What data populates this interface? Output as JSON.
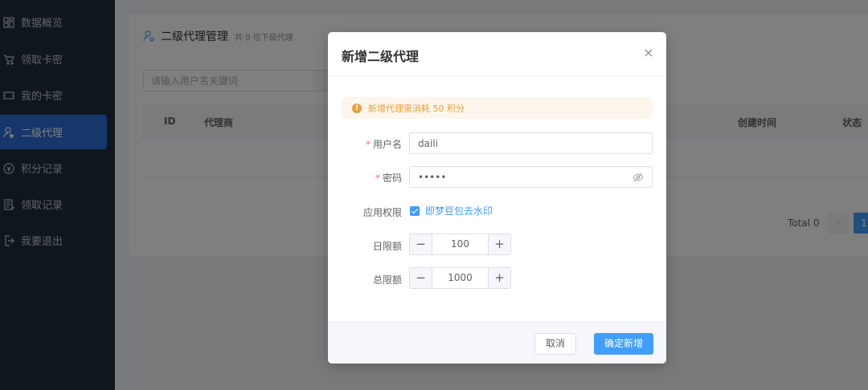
{
  "sidebar": {
    "items": [
      {
        "label": "数据概览",
        "icon": "dashboard-icon"
      },
      {
        "label": "领取卡密",
        "icon": "cart-icon"
      },
      {
        "label": "我的卡密",
        "icon": "ticket-icon"
      },
      {
        "label": "二级代理",
        "icon": "user-agent-icon",
        "active": true
      },
      {
        "label": "积分记录",
        "icon": "coin-icon"
      },
      {
        "label": "领取记录",
        "icon": "record-icon"
      },
      {
        "label": "我要退出",
        "icon": "logout-icon"
      }
    ]
  },
  "page": {
    "title": "二级代理管理",
    "subtitle": "共 0 位下级代理",
    "search_placeholder": "请输入用户名关键词",
    "columns": [
      "ID",
      "代理商",
      "创建时间",
      "状态"
    ],
    "pagination": {
      "total": "Total 0",
      "prev": "‹",
      "current": "1"
    }
  },
  "dialog": {
    "title": "新增二级代理",
    "close": "×",
    "notice": "新增代理需消耗 50 积分",
    "username_label": "用户名",
    "username_value": "daili",
    "password_label": "密码",
    "password_value": "•••••",
    "permission_label": "应用权限",
    "permission_option": "即梦豆包去水印",
    "daily_label": "日限额",
    "daily_value": "100",
    "total_label": "总限额",
    "total_value": "1000",
    "minus": "−",
    "plus": "+",
    "cancel": "取消",
    "confirm": "确定新增"
  },
  "colors": {
    "sidebar_bg": "#1f2d3d",
    "active_item": "#2d6fd6",
    "primary": "#409eff",
    "warning": "#e6a23c",
    "required": "#f56c6c"
  }
}
